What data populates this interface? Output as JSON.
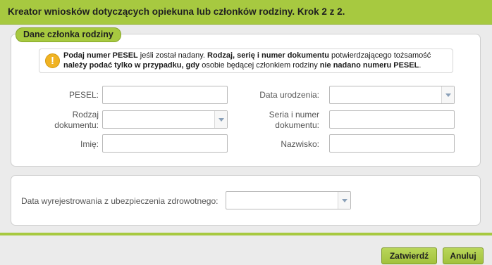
{
  "dialog": {
    "title": "Kreator wniosków dotyczących opiekuna lub członków rodziny. Krok 2 z 2."
  },
  "family_section": {
    "legend": "Dane członka rodziny",
    "info": {
      "icon": "warning-icon",
      "parts": [
        {
          "text": "Podaj numer PESEL",
          "bold": true
        },
        {
          "text": " jeśli został nadany. ",
          "bold": false
        },
        {
          "text": "Rodzaj, serię i numer dokumentu",
          "bold": true
        },
        {
          "text": " potwierdzającego tożsamość ",
          "bold": false
        },
        {
          "text": "należy podać tylko w przypadku, gdy",
          "bold": true
        },
        {
          "text": " osobie będącej członkiem rodziny ",
          "bold": false
        },
        {
          "text": "nie nadano numeru PESEL",
          "bold": true
        },
        {
          "text": ".",
          "bold": false
        }
      ]
    },
    "fields": {
      "pesel": {
        "label": "PESEL:",
        "value": ""
      },
      "birth_date": {
        "label": "Data urodzenia:",
        "value": ""
      },
      "document_type": {
        "label_line1": "Rodzaj",
        "label_line2": "dokumentu:",
        "value": ""
      },
      "document_series": {
        "label_line1": "Seria i numer",
        "label_line2": "dokumentu:",
        "value": ""
      },
      "first_name": {
        "label": "Imię:",
        "value": ""
      },
      "last_name": {
        "label": "Nazwisko:",
        "value": ""
      }
    }
  },
  "insurance_section": {
    "deregistration_date": {
      "label": "Data wyrejestrowania z ubezpieczenia zdrowotnego:",
      "value": ""
    }
  },
  "buttons": {
    "confirm": "Zatwierdź",
    "cancel": "Anuluj"
  },
  "colors": {
    "accent": "#a7c940",
    "warning": "#f0b323"
  }
}
